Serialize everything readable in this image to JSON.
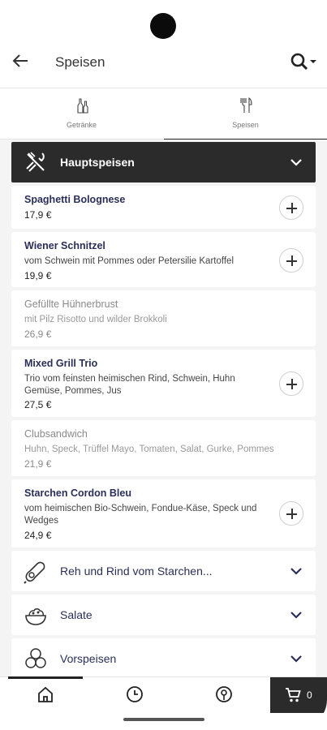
{
  "header": {
    "title": "Speisen",
    "back_icon": "arrow-left-icon",
    "search_icon": "search-dropdown-icon"
  },
  "tabs": [
    {
      "label": "Getränke",
      "icon": "bottles-icon",
      "active": false
    },
    {
      "label": "Speisen",
      "icon": "cutlery-icon",
      "active": true
    }
  ],
  "open_category": {
    "label": "Hauptspeisen",
    "icon": "cutlery-icon"
  },
  "items": [
    {
      "name": "Spaghetti Bolognese",
      "description": "",
      "price": "17,9 €",
      "available": true
    },
    {
      "name": "Wiener Schnitzel",
      "description": "vom Schwein mit Pommes oder Petersilie Kartoffel",
      "price": "19,9 €",
      "available": true
    },
    {
      "name": "Gefüllte Hühnerbrust",
      "description": "mit Pilz Risotto und wilder Brokkoli",
      "price": "26,9 €",
      "available": false
    },
    {
      "name": "Mixed Grill Trio",
      "description": "Trio vom feinsten heimischen Rind, Schwein, Huhn Gemüse, Pommes, Jus",
      "price": "27,5 €",
      "available": true
    },
    {
      "name": "Clubsandwich",
      "description": "Huhn, Speck, Trüffel Mayo, Tomaten, Salat, Gurke, Pommes",
      "price": "21,9 €",
      "available": false
    },
    {
      "name": "Starchen Cordon Bleu",
      "description": "vom heimischen Bio-Schwein, Fondue-Käse, Speck und Wedges",
      "price": "24,9 €",
      "available": true
    }
  ],
  "categories": [
    {
      "label": "Reh und Rind vom Starchen...",
      "icon": "meat-leg-icon"
    },
    {
      "label": "Salate",
      "icon": "salad-bowl-icon"
    },
    {
      "label": "Vorspeisen",
      "icon": "appetizer-icon"
    }
  ],
  "bottom_nav": [
    {
      "icon": "home-icon",
      "active": true
    },
    {
      "icon": "clock-icon",
      "active": false
    },
    {
      "icon": "location-pin-icon",
      "active": false
    }
  ],
  "cart": {
    "icon": "cart-icon",
    "count": "0"
  }
}
